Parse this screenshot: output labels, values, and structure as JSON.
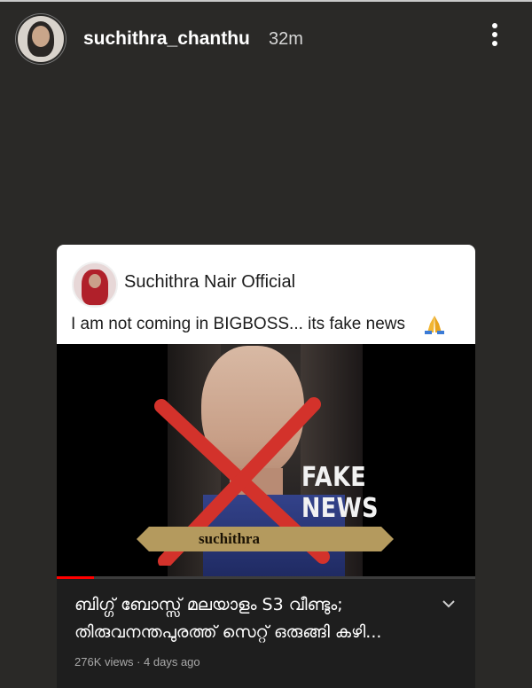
{
  "story": {
    "username": "suchithra_chanthu",
    "time": "32m",
    "avatar_icon": "profile-avatar",
    "menu_icon": "more-vertical-icon"
  },
  "post": {
    "page_name": "Suchithra Nair Official",
    "text": "I am not coming in BIGBOSS... its fake news",
    "emoji_icon": "folded-hands-icon"
  },
  "video": {
    "overlay_text": "FAKE NEWS",
    "banner_text": "suchithra",
    "progress": 0.09,
    "title_line1": "ബിഗ്ഗ് ബോസ്സ് മലയാളം S3 വീണ്ടും;",
    "title_line2": "തിരുവനന്തപുരത്ത് സെറ്റ് ഒരുങ്ങി കഴി...",
    "meta": "276K views · 4 days ago",
    "expand_icon": "chevron-down-icon"
  },
  "colors": {
    "background": "#2a2927",
    "cross": "#d3322b",
    "progress": "#ff0000"
  }
}
